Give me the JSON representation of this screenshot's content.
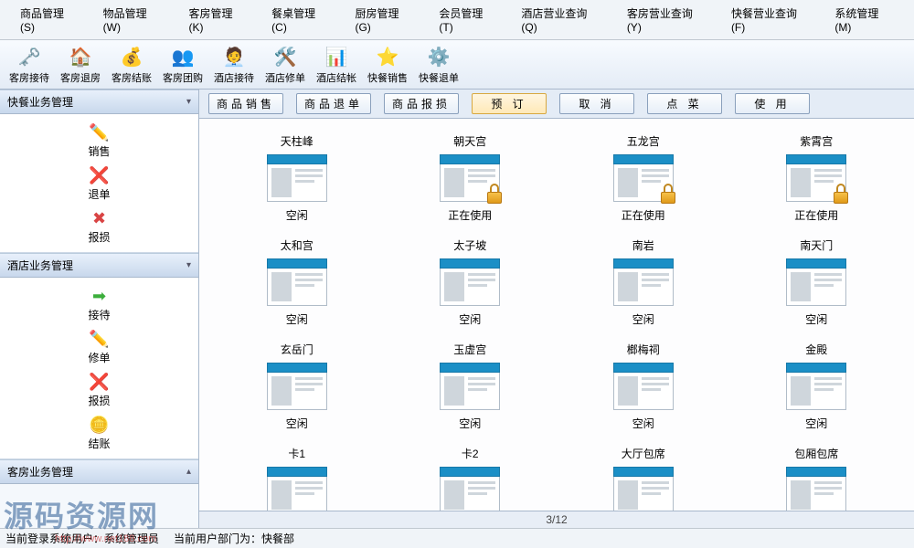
{
  "menu": [
    "商品管理(S)",
    "物品管理(W)",
    "客房管理(K)",
    "餐桌管理(C)",
    "厨房管理(G)",
    "会员管理(T)",
    "酒店营业查询(Q)",
    "客房营业查询(Y)",
    "快餐营业查询(F)",
    "系统管理(M)"
  ],
  "toolbar": [
    {
      "label": "客房接待",
      "icon": "🗝️"
    },
    {
      "label": "客房退房",
      "icon": "🏠"
    },
    {
      "label": "客房结账",
      "icon": "💰"
    },
    {
      "label": "客房团购",
      "icon": "👥"
    },
    {
      "label": "酒店接待",
      "icon": "🧑‍💼"
    },
    {
      "label": "酒店修单",
      "icon": "🛠️"
    },
    {
      "label": "酒店结帐",
      "icon": "📊"
    },
    {
      "label": "快餐销售",
      "icon": "⭐"
    },
    {
      "label": "快餐退单",
      "icon": "⚙️"
    }
  ],
  "sidebar": {
    "panels": [
      {
        "title": "快餐业务管理",
        "items": [
          {
            "label": "销售",
            "icon": "✏️",
            "color": "#d9a441"
          },
          {
            "label": "退单",
            "icon": "❌",
            "color": "#d94444"
          },
          {
            "label": "报损",
            "icon": "✖",
            "color": "#d94444"
          }
        ]
      },
      {
        "title": "酒店业务管理",
        "items": [
          {
            "label": "接待",
            "icon": "➡",
            "color": "#3cae3c"
          },
          {
            "label": "修单",
            "icon": "✏️",
            "color": "#d9a441"
          },
          {
            "label": "报损",
            "icon": "❌",
            "color": "#d94444"
          },
          {
            "label": "结账",
            "icon": "🪙",
            "color": "#d9a441"
          }
        ]
      },
      {
        "title": "客房业务管理",
        "items": []
      }
    ]
  },
  "tabs": [
    "商品销售",
    "商品退单",
    "商品报损",
    "预  订",
    "取  消",
    "点  菜",
    "使  用"
  ],
  "active_tab_index": 3,
  "rooms": [
    {
      "name": "天柱峰",
      "status": "空闲",
      "locked": false
    },
    {
      "name": "朝天宫",
      "status": "正在使用",
      "locked": true
    },
    {
      "name": "五龙宫",
      "status": "正在使用",
      "locked": true
    },
    {
      "name": "紫霄宫",
      "status": "正在使用",
      "locked": true
    },
    {
      "name": "太和宫",
      "status": "空闲",
      "locked": false
    },
    {
      "name": "太子坡",
      "status": "空闲",
      "locked": false
    },
    {
      "name": "南岩",
      "status": "空闲",
      "locked": false
    },
    {
      "name": "南天门",
      "status": "空闲",
      "locked": false
    },
    {
      "name": "玄岳门",
      "status": "空闲",
      "locked": false
    },
    {
      "name": "玉虚宫",
      "status": "空闲",
      "locked": false
    },
    {
      "name": "榔梅祠",
      "status": "空闲",
      "locked": false
    },
    {
      "name": "金殿",
      "status": "空闲",
      "locked": false
    },
    {
      "name": "卡1",
      "status": "",
      "locked": false
    },
    {
      "name": "卡2",
      "status": "",
      "locked": false
    },
    {
      "name": "大厅包席",
      "status": "",
      "locked": false
    },
    {
      "name": "包厢包席",
      "status": "",
      "locked": false
    }
  ],
  "pager": "3/12",
  "footer": {
    "user_label": "当前登录系统用户：",
    "user": "系统管理员",
    "dept_label": "当前用户部门为：",
    "dept": "快餐部"
  },
  "watermark": "源码资源网",
  "watermark_url": "http://www.net188.com"
}
